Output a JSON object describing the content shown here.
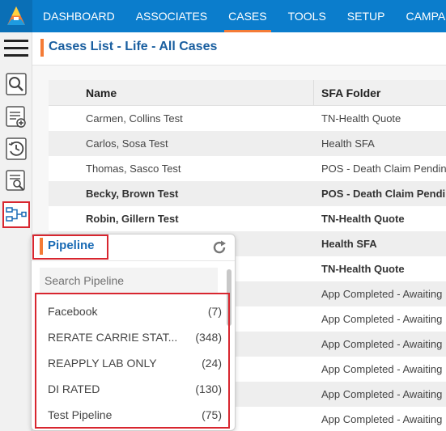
{
  "nav": {
    "items": [
      "DASHBOARD",
      "ASSOCIATES",
      "CASES",
      "TOOLS",
      "SETUP",
      "CAMPAIGN"
    ],
    "active": "CASES"
  },
  "page": {
    "title": "Cases List - Life - All Cases"
  },
  "table": {
    "columns": [
      "Name",
      "SFA Folder"
    ],
    "rows": [
      {
        "name": "Carmen, Collins Test",
        "sfa": "TN-Health Quote"
      },
      {
        "name": "Carlos, Sosa Test",
        "sfa": "Health SFA"
      },
      {
        "name": "Thomas, Sasco Test",
        "sfa": "POS - Death Claim Pending"
      },
      {
        "name": "Becky, Brown Test",
        "sfa": "POS - Death Claim Pending"
      },
      {
        "name": "Robin, Gillern Test",
        "sfa": "TN-Health Quote"
      },
      {
        "name": "",
        "sfa": "Health SFA"
      },
      {
        "name": "",
        "sfa": "TN-Health Quote"
      },
      {
        "name": "",
        "sfa": "App Completed - Awaiting"
      },
      {
        "name": "",
        "sfa": "App Completed - Awaiting"
      },
      {
        "name": "",
        "sfa": "App Completed - Awaiting"
      },
      {
        "name": "",
        "sfa": "App Completed - Awaiting"
      },
      {
        "name": "",
        "sfa": "App Completed - Awaiting"
      },
      {
        "name": "",
        "sfa": "App Completed - Awaiting"
      }
    ]
  },
  "pipeline": {
    "title": "Pipeline",
    "search_placeholder": "Search Pipeline",
    "items": [
      {
        "name": "Facebook",
        "count": "(7)"
      },
      {
        "name": "RERATE CARRIE STAT...",
        "count": "(348)"
      },
      {
        "name": "REAPPLY LAB ONLY",
        "count": "(24)"
      },
      {
        "name": "DI RATED",
        "count": "(130)"
      },
      {
        "name": "Test Pipeline",
        "count": "(75)"
      }
    ]
  },
  "icons": {
    "logo": "app-logo-icon",
    "menu": "hamburger-menu-icon",
    "tools": [
      "search-tool-icon",
      "add-list-icon",
      "history-icon",
      "document-search-icon",
      "folder-transfer-icon",
      "pipeline-icon"
    ],
    "refresh": "refresh-icon"
  },
  "colors": {
    "topbar": "#0b7dcc",
    "accent": "#f47b36",
    "highlight": "#d8262f",
    "title": "#1a5fa0"
  }
}
